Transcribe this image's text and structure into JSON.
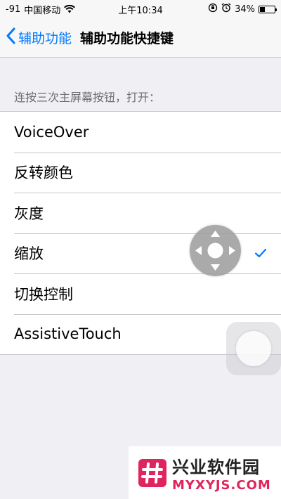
{
  "status_bar": {
    "signal": "-91",
    "carrier": "中国移动",
    "time": "上午10:34",
    "battery": "34%",
    "battery_level": 0.34
  },
  "nav": {
    "back_label": "辅助功能",
    "title": "辅助功能快捷键"
  },
  "section_header": "连按三次主屏幕按钮，打开：",
  "list": {
    "items": [
      {
        "label": "VoiceOver",
        "checked": false
      },
      {
        "label": "反转颜色",
        "checked": false
      },
      {
        "label": "灰度",
        "checked": false
      },
      {
        "label": "缩放",
        "checked": true
      },
      {
        "label": "切换控制",
        "checked": false
      },
      {
        "label": "AssistiveTouch",
        "checked": false
      }
    ]
  },
  "watermark": {
    "title": "兴业软件园",
    "url": "MYXYJS.COM"
  },
  "colors": {
    "accent": "#007aff",
    "background": "#efeff4",
    "watermark_accent": "#e0245e"
  }
}
